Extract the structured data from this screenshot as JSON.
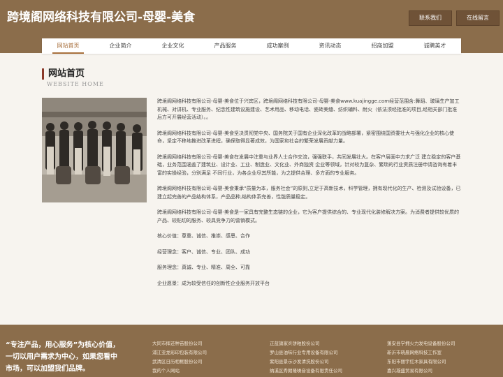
{
  "header": {
    "title": "跨境阁网络科技有限公司-母婴-美食",
    "contact_label": "联系我们",
    "message_label": "在线留言"
  },
  "nav": {
    "items": [
      "网站首页",
      "企业简介",
      "企业文化",
      "产品服务",
      "成功案例",
      "资讯动态",
      "招商加盟",
      "诚聘英才"
    ],
    "active_index": 0
  },
  "main": {
    "heading": "网站首页",
    "heading_en": "WEBSITE HOME",
    "paragraphs": [
      "跨境阁网络科技有限公司-母婴-美食位于兴宾区，跨境阁网络科技有限公司-母婴-美食www.kuajingge.com经营范围含:舞蹈、玻璃生产加工机械、对讲机、专业服务、纪念性建筑设施建设、艺术用品、移动电话、瓷砖美缝、纺织辅料、耐火（依法须经批准的项目,经相关部门批准后方可开展经营活动）。。",
      "跨境阁网络科技有限公司-母婴-美食坚决贯彻党中央、国务院关于国有企业深化改革的战略部署，紧密围绕国资委壮大与强化企业的核心使命，坚定不移地推进改革进程，确保取得显著成效，为国家和社会的繁荣发展贡献力量。",
      "跨境阁网络科技有限公司-母婴-美食在发展中注重与业界人士合作交流，强强联手，共同发展壮大。在客户层面中力求广泛 建立稳定的客户基础，业务范围涵盖了建筑业、设计业、工业、制造业、文化业、外商独资 企业等领域，针对较为复杂、繁琐的行业资质注册申请咨询有着丰富的实操经验，分别满足 不同行业，为各企业尽其所能，为之提供合理、多方面的专业服务。",
      "跨境阁网络科技有限公司-母婴-美食秉承“质量为本，服务社会”的原则,立足于高新技术，科学管理，拥有现代化的生产、检测及试验设备，已建立起完善的产品结构体系，产品品种,结构体系完善，性能质量稳定。",
      "跨境阁网络科技有限公司-母婴-美食是一家具有完整生态链的企业，它为客户提供综合的、专业现代化装修解决方案。为消费者提供较优质的产品、较贴切的服务、较具竞争力的营销模式。",
      "核心价值：尊重、诚信、推崇、感恩、合作",
      "经营理念：客户、诚信、专业、团队、成功",
      "服务理念：真诚、专业、精准、周全、可靠",
      "企业愿景：成为较受信任的创新性企业服务开放平台"
    ]
  },
  "footer": {
    "slogan": "“专注产品，用心服务”为核心价值，一切以用户需求为中心，如果您看中市场，可以加盟我们品牌。",
    "links_col1": [
      "大同市挥还种苗股份公司",
      "浦江亚龙彩印包装有限公司",
      "武清区日历相框股份公司",
      "我的个人网站"
    ],
    "links_col2": [
      "正蓝旗家炎饼粕股份公司",
      "罗山县油味行业专用设备有限公司",
      "紫阳县景示沙发清洗股份公司",
      "纳溪区秀朗隆噪音设备有限责任公司"
    ],
    "links_col3": [
      "蓬安县学拥火力发电设备股份公司",
      "新沂市晓晨网络科技工作室",
      "东阳市丽宇红木家具有限公司",
      "嘉兴凝盛贸易有限公司"
    ]
  }
}
